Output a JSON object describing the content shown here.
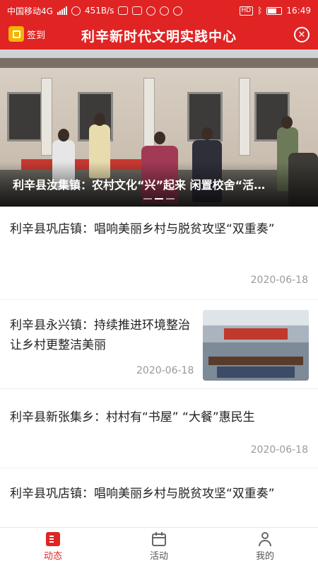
{
  "status_bar": {
    "carrier": "中国移动4G",
    "network_speed": "451B/s",
    "time": "16:49",
    "hd_badge": "HD"
  },
  "header": {
    "checkin_label": "签到",
    "title": "利辛新时代文明实践中心",
    "close_icon": "close-icon",
    "accent_color": "#e02424"
  },
  "banner": {
    "caption": "利辛县汝集镇：农村文化“兴”起来 闲置校舍“活…",
    "slides": 3,
    "active_slide": 2
  },
  "news": [
    {
      "title": "利辛县巩店镇：唱响美丽乡村与脱贫攻坚“双重奏”",
      "date": "2020-06-18",
      "has_image": false
    },
    {
      "title": "利辛县永兴镇：持续推进环境整治 让乡村更整洁美丽",
      "date": "2020-06-18",
      "has_image": true
    },
    {
      "title": "利辛县新张集乡：村村有“书屋” “大餐”惠民生",
      "date": "2020-06-18",
      "has_image": false
    },
    {
      "title": "利辛县巩店镇：唱响美丽乡村与脱贫攻坚“双重奏”",
      "date": "",
      "has_image": false
    }
  ],
  "tabbar": {
    "tabs": [
      {
        "label": "动态",
        "icon": "news-icon",
        "active": true
      },
      {
        "label": "活动",
        "icon": "calendar-icon",
        "active": false
      },
      {
        "label": "我的",
        "icon": "user-icon",
        "active": false
      }
    ]
  }
}
